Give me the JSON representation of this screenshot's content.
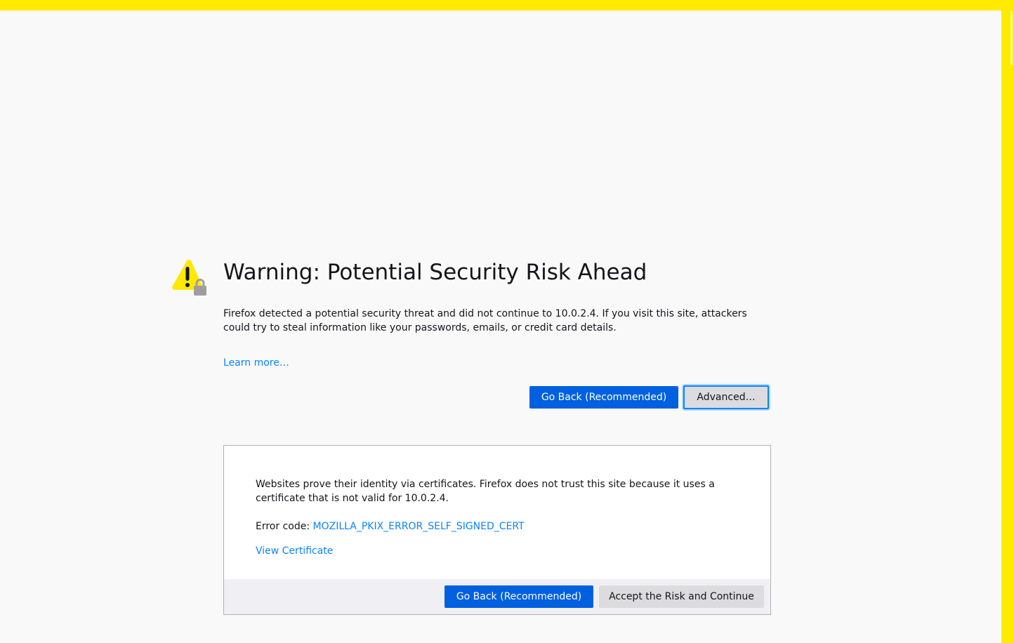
{
  "colors": {
    "accent": "#0060df",
    "link": "#0a84ff",
    "warning": "#ffe900",
    "frame": "#ffea00"
  },
  "icon": {
    "name": "warning-lock-icon"
  },
  "warning": {
    "title": "Warning: Potential Security Risk Ahead",
    "description": "Firefox detected a potential security threat and did not continue to 10.0.2.4. If you visit this site, attackers could try to steal information like your passwords, emails, or credit card details.",
    "learn_more": "Learn more…",
    "go_back_label": "Go Back (Recommended)",
    "advanced_label": "Advanced…"
  },
  "advanced_panel": {
    "explanation": "Websites prove their identity via certificates. Firefox does not trust this site because it uses a certificate that is not valid for 10.0.2.4.",
    "error_code_prefix": "Error code: ",
    "error_code": "MOZILLA_PKIX_ERROR_SELF_SIGNED_CERT",
    "view_certificate": "View Certificate",
    "go_back_label": "Go Back (Recommended)",
    "accept_label": "Accept the Risk and Continue"
  }
}
